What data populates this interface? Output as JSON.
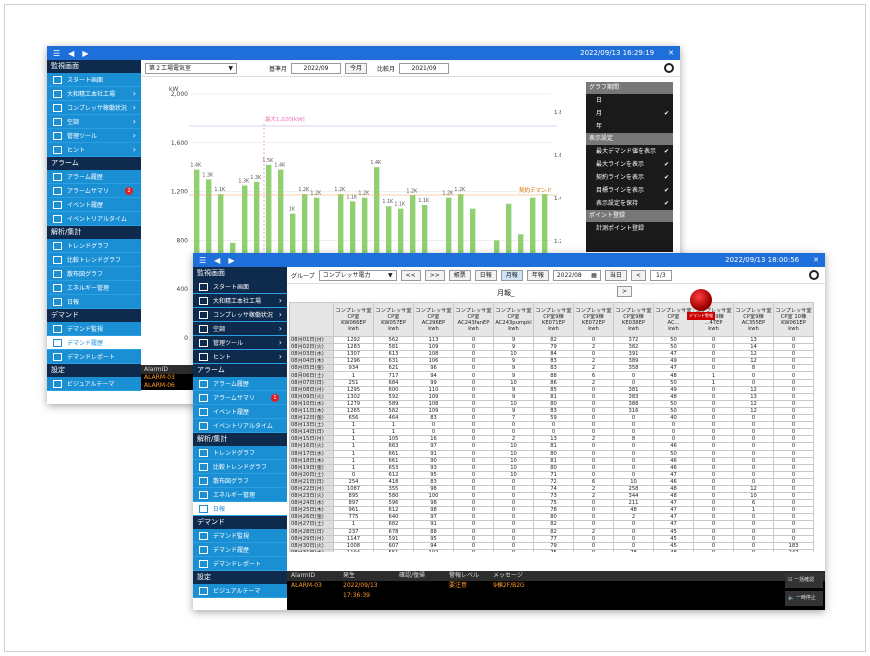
{
  "win1": {
    "datetime": "2022/09/13 16:29:19",
    "group": "第２工場電気室",
    "base_label": "基準月",
    "base_value": "2022/09",
    "this_month": "今月",
    "cmp_label": "比較月",
    "cmp_value": "2021/09",
    "y_unit": "kW",
    "max_label": "最大1,020[kW]",
    "contract_label": "契約デマンド",
    "panel": {
      "h1": "グラフ期間",
      "p1": [
        "日",
        "月",
        "年"
      ],
      "h2": "表示設定",
      "p2": [
        "最大デマンド値を表示",
        "最大ラインを表示",
        "契約ラインを表示",
        "目標ラインを表示",
        "表示設定を保持"
      ],
      "h3": "ポイント登録",
      "p3": [
        "計測ポイント登録"
      ]
    },
    "alarm_header": "AlarmID",
    "alarm_rows": [
      "ALARM-03",
      "ALARM-06"
    ]
  },
  "chart_data": {
    "type": "bar",
    "x": [
      1,
      2,
      3,
      4,
      5,
      6,
      7,
      8,
      9,
      10,
      11,
      12,
      13,
      14,
      15,
      16,
      17,
      18,
      19,
      20,
      21,
      22,
      23,
      24,
      25,
      26,
      27,
      28,
      29,
      30
    ],
    "ylim": [
      0,
      2000
    ],
    "y_ticks": [
      0,
      400,
      800,
      1200,
      1600,
      2000
    ],
    "y_right_ticks": [
      "1.8K",
      "1.6K",
      "1.4K",
      "1.2K",
      "1K",
      "800"
    ],
    "data_labels": [
      "1.4K",
      "1.3K",
      "1.1K",
      "",
      "1.3K",
      "1.3K",
      "1.5K",
      "1.4K",
      "1K",
      "1.2K",
      "1.2K",
      "",
      "1.2K",
      "1.1K",
      "1.2K",
      "1.4K",
      "1.1K",
      "1.1K",
      "1.2K",
      "1.1K",
      "",
      "1.2K",
      "1.2K"
    ],
    "values": [
      1380,
      1300,
      1180,
      780,
      1250,
      1280,
      1420,
      1380,
      1020,
      1180,
      1150,
      450,
      1180,
      1120,
      1150,
      1400,
      1080,
      1060,
      1170,
      1090,
      500,
      1150,
      1180,
      1060,
      600,
      800,
      1100,
      850,
      1150,
      1180
    ],
    "series_colors": [
      "#7dc857",
      "#4f7fd6"
    ]
  },
  "win2": {
    "datetime": "2022/09/13 18:00:56",
    "group_label": "グループ",
    "group": "コンプレッサ電力",
    "nav": [
      "<<",
      ">>"
    ],
    "modes": [
      "帳票",
      "日報",
      "月報",
      "年報"
    ],
    "date": "2022/08",
    "today": "当日",
    "page": "1/3",
    "caption": "月報_",
    "headers": [
      [
        "コンプレッサ室",
        "CP室",
        "KW066EP",
        "kwh"
      ],
      [
        "コンプレッサ室",
        "CP室",
        "KW057EP",
        "kwh"
      ],
      [
        "コンプレッサ室",
        "CP室",
        "AC296EP",
        "kwh"
      ],
      [
        "コンプレッサ室",
        "CP室",
        "AC243fanEP",
        "kwh"
      ],
      [
        "コンプレッサ室",
        "CP室",
        "AC243pumpkl",
        "kwh"
      ],
      [
        "コンプレッサ室",
        "CP室9棟",
        "KE071EP",
        "kwh"
      ],
      [
        "コンプレッサ室",
        "CP室9棟",
        "KE072EP",
        "kwh"
      ],
      [
        "コンプレッサ室",
        "CP室9棟",
        "KE038EP",
        "kwh"
      ],
      [
        "コンプレッサ室",
        "CP室",
        "AC...",
        "kwh"
      ],
      [
        "コンプレッサ室",
        "CP室9棟",
        "...47EP",
        "kwh"
      ],
      [
        "コンプレッサ室",
        "CP室9棟",
        "AC355EP",
        "kwh"
      ],
      [
        "コンプレッサ室",
        "CP室 10棟",
        "KW061EP",
        "kwh"
      ]
    ],
    "rows": [
      [
        "08月01日(月)",
        "1292",
        "562",
        "113",
        "0",
        "9",
        "82",
        "0",
        "372",
        "50",
        "0",
        "13",
        "0"
      ],
      [
        "08月02日(火)",
        "1283",
        "581",
        "109",
        "0",
        "9",
        "79",
        "2",
        "382",
        "50",
        "0",
        "14",
        "0"
      ],
      [
        "08月03日(水)",
        "1307",
        "613",
        "108",
        "0",
        "10",
        "84",
        "0",
        "391",
        "47",
        "0",
        "12",
        "0"
      ],
      [
        "08月04日(木)",
        "1296",
        "631",
        "106",
        "0",
        "9",
        "83",
        "2",
        "389",
        "49",
        "0",
        "12",
        "0"
      ],
      [
        "08月05日(金)",
        "934",
        "621",
        "96",
        "0",
        "9",
        "83",
        "2",
        "358",
        "47",
        "0",
        "8",
        "0"
      ],
      [
        "08月06日(土)",
        "1",
        "717",
        "94",
        "0",
        "9",
        "88",
        "6",
        "0",
        "48",
        "1",
        "0",
        "0"
      ],
      [
        "08月07日(日)",
        "251",
        "684",
        "99",
        "0",
        "10",
        "86",
        "2",
        "0",
        "50",
        "1",
        "0",
        "0"
      ],
      [
        "08月08日(月)",
        "1295",
        "600",
        "110",
        "0",
        "9",
        "85",
        "0",
        "381",
        "49",
        "0",
        "12",
        "0"
      ],
      [
        "08月09日(火)",
        "1302",
        "592",
        "109",
        "0",
        "9",
        "81",
        "0",
        "383",
        "48",
        "0",
        "13",
        "0"
      ],
      [
        "08月10日(水)",
        "1279",
        "589",
        "108",
        "0",
        "10",
        "80",
        "0",
        "388",
        "50",
        "0",
        "12",
        "0"
      ],
      [
        "08月11日(木)",
        "1265",
        "582",
        "109",
        "0",
        "9",
        "83",
        "0",
        "316",
        "50",
        "0",
        "12",
        "0"
      ],
      [
        "08月12日(金)",
        "656",
        "464",
        "83",
        "0",
        "7",
        "59",
        "0",
        "0",
        "40",
        "0",
        "0",
        "0"
      ],
      [
        "08月13日(土)",
        "1",
        "1",
        "0",
        "0",
        "0",
        "0",
        "0",
        "0",
        "0",
        "0",
        "0",
        "0"
      ],
      [
        "08月14日(日)",
        "1",
        "1",
        "0",
        "0",
        "0",
        "0",
        "0",
        "0",
        "0",
        "0",
        "0",
        "0"
      ],
      [
        "08月15日(月)",
        "1",
        "105",
        "16",
        "0",
        "2",
        "13",
        "2",
        "8",
        "0",
        "0",
        "0",
        "0"
      ],
      [
        "08月16日(火)",
        "1",
        "663",
        "97",
        "0",
        "10",
        "81",
        "0",
        "0",
        "46",
        "0",
        "0",
        "0"
      ],
      [
        "08月17日(水)",
        "1",
        "661",
        "91",
        "0",
        "10",
        "80",
        "0",
        "0",
        "50",
        "0",
        "0",
        "0"
      ],
      [
        "08月18日(木)",
        "1",
        "661",
        "90",
        "0",
        "10",
        "81",
        "0",
        "0",
        "46",
        "0",
        "0",
        "0"
      ],
      [
        "08月19日(金)",
        "1",
        "653",
        "93",
        "0",
        "10",
        "80",
        "0",
        "0",
        "46",
        "0",
        "0",
        "0"
      ],
      [
        "08月20日(土)",
        "0",
        "612",
        "95",
        "0",
        "10",
        "71",
        "0",
        "0",
        "47",
        "0",
        "0",
        "0"
      ],
      [
        "08月21日(日)",
        "254",
        "418",
        "83",
        "0",
        "0",
        "72",
        "6",
        "10",
        "46",
        "0",
        "0",
        "0"
      ],
      [
        "08月22日(月)",
        "1087",
        "355",
        "98",
        "0",
        "0",
        "74",
        "2",
        "258",
        "48",
        "0",
        "12",
        "0"
      ],
      [
        "08月23日(火)",
        "895",
        "580",
        "100",
        "0",
        "0",
        "73",
        "2",
        "344",
        "48",
        "0",
        "10",
        "0"
      ],
      [
        "08月24日(水)",
        "897",
        "596",
        "98",
        "0",
        "0",
        "75",
        "0",
        "211",
        "47",
        "0",
        "6",
        "0"
      ],
      [
        "08月25日(木)",
        "961",
        "612",
        "98",
        "0",
        "0",
        "78",
        "0",
        "48",
        "47",
        "0",
        "1",
        "0"
      ],
      [
        "08月26日(金)",
        "775",
        "640",
        "97",
        "0",
        "0",
        "80",
        "0",
        "2",
        "47",
        "0",
        "0",
        "0"
      ],
      [
        "08月27日(土)",
        "1",
        "682",
        "91",
        "0",
        "0",
        "82",
        "0",
        "0",
        "47",
        "0",
        "0",
        "0"
      ],
      [
        "08月28日(日)",
        "237",
        "678",
        "88",
        "0",
        "0",
        "82",
        "2",
        "0",
        "45",
        "0",
        "0",
        "0"
      ],
      [
        "08月29日(月)",
        "1147",
        "591",
        "95",
        "0",
        "0",
        "77",
        "0",
        "0",
        "45",
        "0",
        "0",
        "0"
      ],
      [
        "08月30日(火)",
        "1008",
        "607",
        "94",
        "0",
        "0",
        "79",
        "0",
        "0",
        "45",
        "0",
        "0",
        "183"
      ],
      [
        "08月31日(水)",
        "1194",
        "551",
        "102",
        "0",
        "0",
        "75",
        "0",
        "78",
        "48",
        "0",
        "0",
        "247"
      ],
      [
        "合計",
        "20626",
        "16919",
        "2770",
        "0",
        "109",
        "2225",
        "28",
        "4429",
        "1343",
        "1",
        "143",
        "430"
      ],
      [
        "平均",
        "665",
        "546",
        "89",
        "0",
        "4",
        "72",
        "1",
        "143",
        "43",
        "0",
        "5",
        "14"
      ],
      [
        "最大",
        "1307",
        "717",
        "113",
        "0",
        "10",
        "88",
        "6",
        "391",
        "50",
        "1",
        "14",
        "247"
      ],
      [
        "最小",
        "0",
        "1",
        "0",
        "0",
        "0",
        "0",
        "0",
        "0",
        "0",
        "0",
        "0",
        "0"
      ]
    ],
    "alarm_cols": [
      "AlarmID",
      "発生",
      "確認/復帰",
      "警報レベル",
      "メッセージ"
    ],
    "alarm_row": [
      "ALARM-03",
      "2022/09/13 17:36:39",
      "",
      "要注意",
      "9棟2F/B2G"
    ],
    "btn_confirm": "一括確認",
    "btn_stop": "一時停止"
  },
  "sidebar": {
    "s1": "監視画面",
    "g1": [
      "スタート画面",
      "大和精工本社工場",
      "コンプレッサ稼働状況",
      "空調",
      "管理ツール",
      "ヒント"
    ],
    "s2": "アラーム",
    "g2": [
      "アラーム履歴",
      "アラームサマリ",
      "イベント履歴",
      "イベントリアルタイム"
    ],
    "badge1": "2",
    "badge2": "1",
    "s3": "解析/集計",
    "g3": [
      "トレンドグラフ",
      "比較トレンドグラフ",
      "散布図グラフ",
      "エネルギー管理",
      "日報"
    ],
    "s4": "デマンド",
    "g4": [
      "デマンド監視",
      "デマンド履歴",
      "デマンドレポート"
    ],
    "s5": "設定",
    "g5": [
      "ビジュアルテーマ"
    ]
  },
  "demand_label": "デマンド警報"
}
